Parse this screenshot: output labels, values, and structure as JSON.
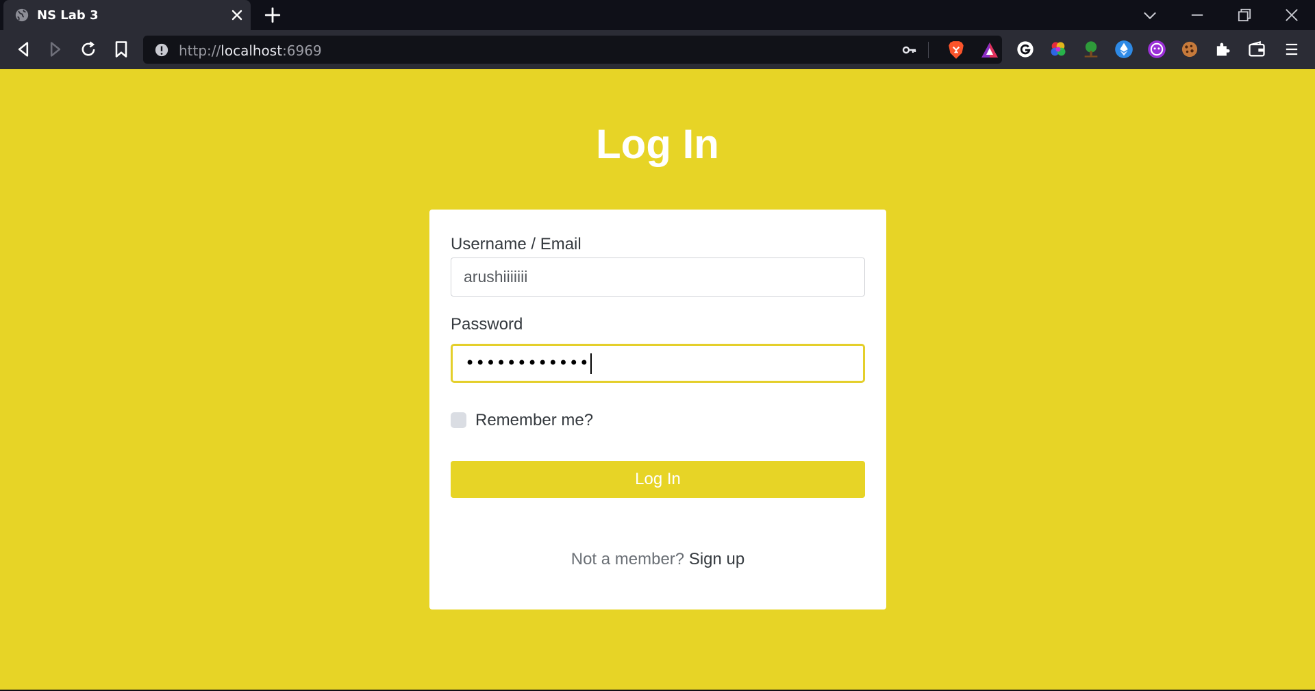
{
  "browser": {
    "tab": {
      "title": "NS Lab 3",
      "favicon": "globe-icon"
    },
    "url": {
      "scheme": "http://",
      "host": "localhost",
      "port": ":6969"
    },
    "toolbar_icons": [
      "back-icon",
      "forward-icon",
      "reload-icon",
      "bookmark-icon",
      "site-info-icon",
      "key-icon",
      "brave-shields-icon",
      "brave-rewards-icon"
    ],
    "extension_icons": [
      "grammarly-icon",
      "color-picker-icon",
      "tree-extension-icon",
      "ethereum-icon",
      "crypto-face-icon",
      "cookie-icon",
      "extensions-puzzle-icon",
      "wallet-icon",
      "menu-icon"
    ],
    "colors": {
      "tabbar": "#0f1018",
      "toolbar": "#2b2c35",
      "urlbar": "#111218"
    }
  },
  "page": {
    "title": "Log In",
    "background": "#e7d426",
    "form": {
      "username_label": "Username / Email",
      "username_value": "arushiiiiiii",
      "password_label": "Password",
      "password_masked": "••••••••••••",
      "remember_label": "Remember me?",
      "remember_checked": false,
      "submit_label": "Log In"
    },
    "footer": {
      "prompt": "Not a member?",
      "link": "Sign up"
    }
  }
}
